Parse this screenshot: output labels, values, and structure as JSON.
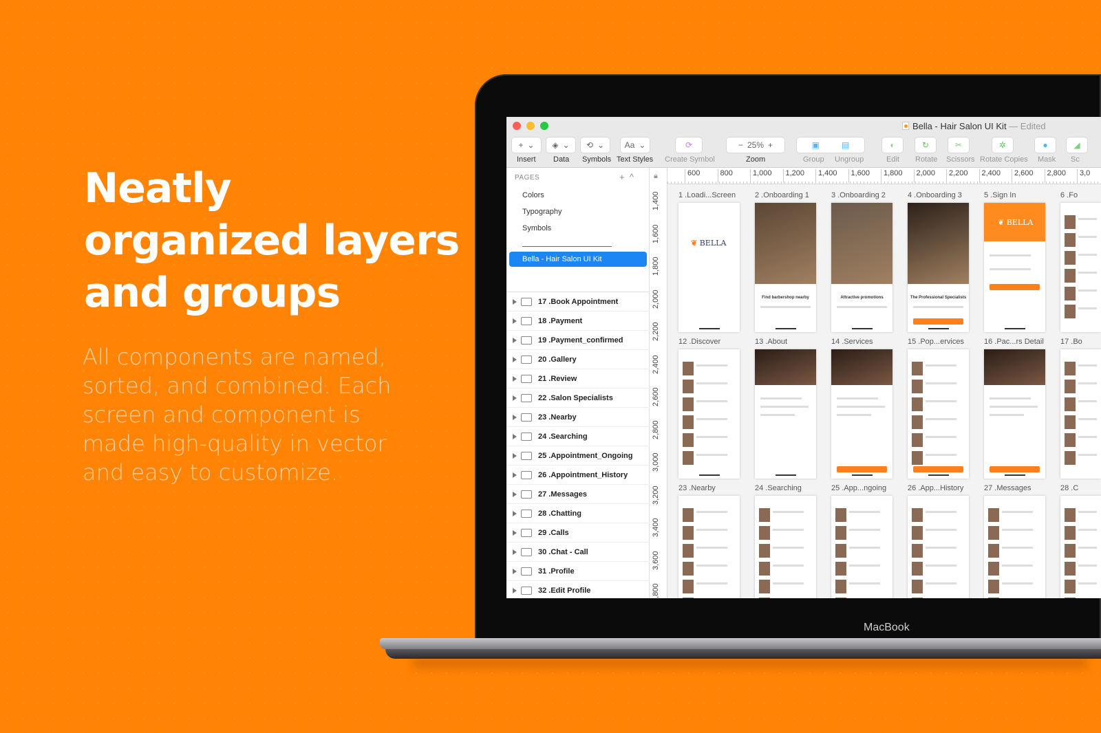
{
  "promo": {
    "headline": [
      "Neatly",
      "organized layers",
      "and groups"
    ],
    "paragraph": "All components are named, sorted, and combined. Each screen and component is made high-quality in vector and easy to customize.",
    "device_label": "MacBook",
    "background_color": "#ff8304"
  },
  "window": {
    "title": "Bella - Hair Salon UI Kit",
    "status": "— Edited",
    "traffic_lights": [
      "#fe5f57",
      "#febc2e",
      "#28c840"
    ]
  },
  "toolbar": {
    "zoom_value": "25%",
    "text_styles_button": "Aa",
    "items": [
      "Insert",
      "Data",
      "Symbols",
      "Text Styles",
      "Create Symbol",
      "Zoom",
      "Group",
      "Ungroup",
      "Edit",
      "Rotate",
      "Scissors",
      "Rotate Copies",
      "Mask",
      "Sc"
    ]
  },
  "rulers": {
    "horizontal": [
      "600",
      "800",
      "1,000",
      "1,200",
      "1,400",
      "1,600",
      "1,800",
      "2,000",
      "2,200",
      "2,400",
      "2,600",
      "2,800",
      "3,0"
    ],
    "vertical": [
      "1,400",
      "1,600",
      "1,800",
      "2,000",
      "2,200",
      "2,400",
      "2,600",
      "2,800",
      "3,000",
      "3,200",
      "3,400",
      "3,600",
      "3,800"
    ]
  },
  "sidebar": {
    "pages_header": "PAGES",
    "pages": [
      "Colors",
      "Typography",
      "Symbols"
    ],
    "selected_page": "Bella - Hair Salon UI Kit",
    "accent": "#1c86f5",
    "layers": [
      "17 .Book Appointment",
      "18 .Payment",
      "19 .Payment_confirmed",
      "20 .Gallery",
      "21 .Review",
      "22 .Salon Specialists",
      "23 .Nearby",
      "24 .Searching",
      "25 .Appointment_Ongoing",
      "26 .Appointment_History",
      "27 .Messages",
      "28 .Chatting",
      "29 .Calls",
      "30 .Chat - Call",
      "31 .Profile",
      "32 .Edit Profile"
    ]
  },
  "canvas": {
    "artboards": [
      [
        "1 .Loadi...Screen",
        "2 .Onboarding 1",
        "3 .Onboarding 2",
        "4 .Onboarding 3",
        "5 .Sign In",
        "6 .Fo"
      ],
      [
        "12 .Discover",
        "13 .About",
        "14 .Services",
        "15 .Pop...ervices",
        "16 .Pac...rs Detail",
        "17 .Bo"
      ],
      [
        "23 .Nearby",
        "24 .Searching",
        "25 .App...ngoing",
        "26 .App...History",
        "27 .Messages",
        "28 .C"
      ]
    ],
    "onboarding_titles": [
      "Find barbershop nearby",
      "Attractive promotions",
      "The Professional Specialists"
    ],
    "logo_text": "BELLA",
    "brand_color": "#ff7f1a"
  }
}
